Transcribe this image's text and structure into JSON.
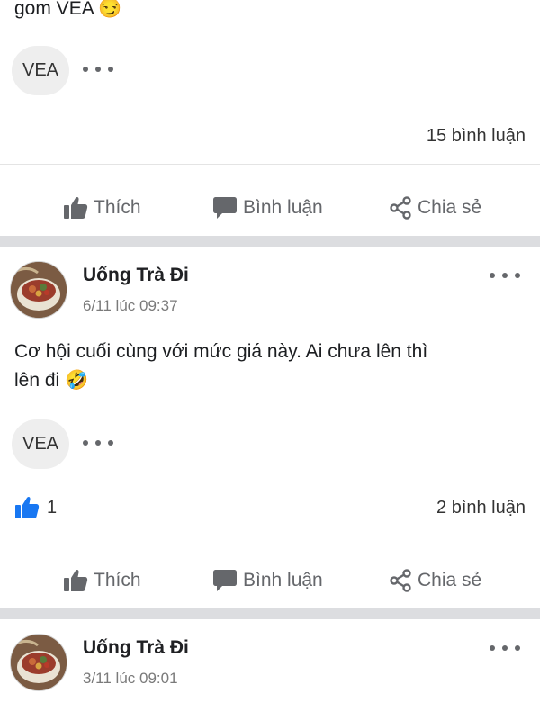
{
  "colors": {
    "separator": "#dcdde0",
    "accent_like": "#1877f2",
    "muted": "#65676b"
  },
  "post0": {
    "text_tail": "gom VEA 😏",
    "tag": "VEA",
    "comments": "15 bình luận",
    "actions": {
      "like": "Thích",
      "comment": "Bình luận",
      "share": "Chia sẻ"
    }
  },
  "post1": {
    "author": "Uống Trà Đi",
    "time": "6/11 lúc 09:37",
    "text_line1": "Cơ hội cuối cùng với mức giá này. Ai chưa lên thì",
    "text_line2": "lên đi 🤣",
    "tag": "VEA",
    "likes": "1",
    "comments": "2 bình luận",
    "actions": {
      "like": "Thích",
      "comment": "Bình luận",
      "share": "Chia sẻ"
    }
  },
  "post2": {
    "author": "Uống Trà Đi",
    "time": "3/11 lúc 09:01"
  }
}
